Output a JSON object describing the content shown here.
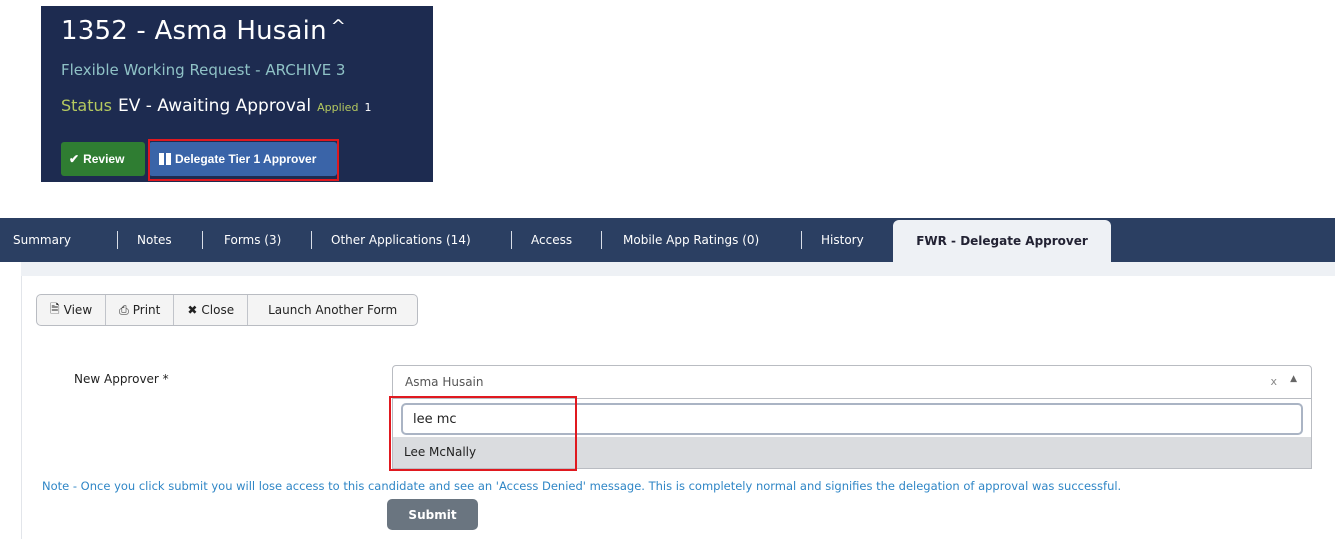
{
  "header": {
    "title": "1352 - Asma Husain",
    "caret": "^",
    "subtitle": "Flexible Working Request - ARCHIVE 3",
    "status_label": "Status",
    "status_value": "EV - Awaiting Approval",
    "applied_label": "Applied",
    "applied_value_truncated": "1",
    "review_label": "Review",
    "delegate_label": "Delegate Tier 1 Approver"
  },
  "tabs": [
    {
      "label": "Summary"
    },
    {
      "label": "Notes"
    },
    {
      "label": "Forms (3)"
    },
    {
      "label": "Other Applications (14)"
    },
    {
      "label": "Access"
    },
    {
      "label": "Mobile App Ratings (0)"
    },
    {
      "label": "History"
    },
    {
      "label": "FWR - Delegate Approver",
      "active": true
    }
  ],
  "toolbar": {
    "view": "View",
    "print": "Print",
    "close": "Close",
    "launch": "Launch Another Form"
  },
  "form": {
    "approver_label": "New Approver *",
    "approver_selected": "Asma Husain",
    "clear_symbol": "x",
    "search_value": "lee mc",
    "option": "Lee McNally",
    "note": "Note - Once you click submit you will lose access to this candidate and see an 'Access Denied' message. This is completely normal and signifies the delegation of approval was successful.",
    "submit": "Submit"
  },
  "colors": {
    "header_bg": "#1d2b50",
    "tabbar_bg": "#2b3f62",
    "highlight": "#e0191f",
    "review_green": "#2f7d32",
    "delegate_blue": "#3a64a8",
    "note_blue": "#2f86c6"
  }
}
